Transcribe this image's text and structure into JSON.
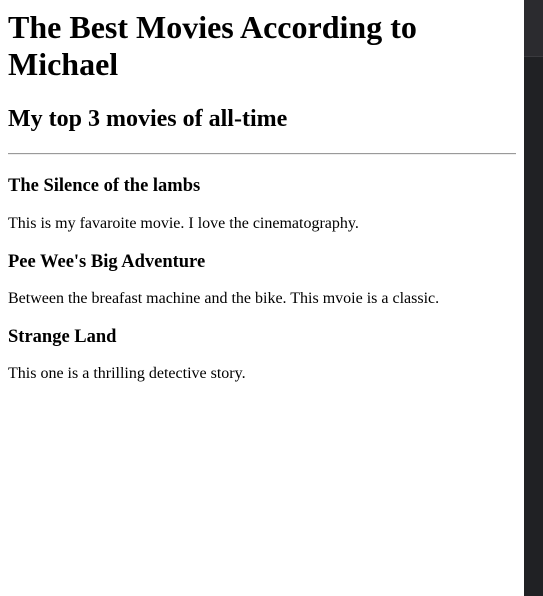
{
  "page": {
    "title": "The Best Movies According to Michael",
    "subtitle": "My top 3 movies of all-time"
  },
  "movies": [
    {
      "title": "The Silence of the lambs",
      "description": "This is my favaroite movie. I love the cinematography."
    },
    {
      "title": "Pee Wee's Big Adventure",
      "description": "Between the breafast machine and the bike. This mvoie is a classic."
    },
    {
      "title": "Strange Land",
      "description": "This one is a thrilling detective story."
    }
  ],
  "colors": {
    "background": "#ffffff",
    "text": "#000000",
    "scrollbar": "#202124"
  }
}
